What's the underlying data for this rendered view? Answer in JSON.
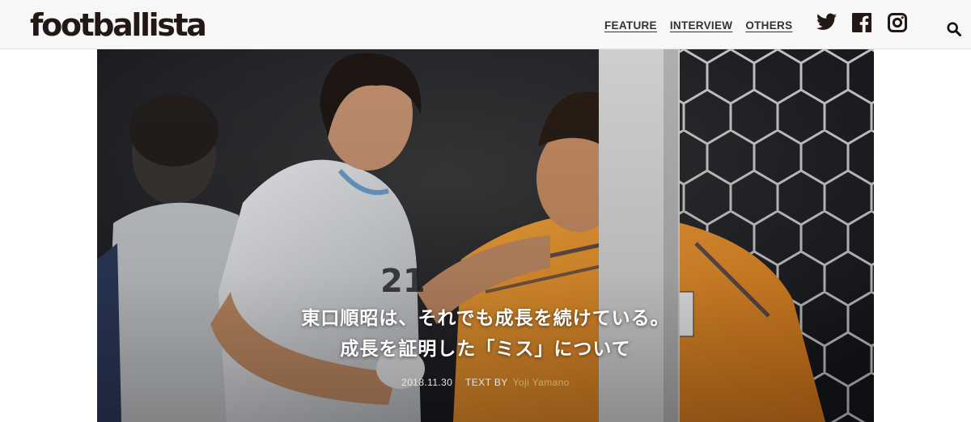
{
  "header": {
    "logo": "footballista",
    "nav": [
      {
        "label": "FEATURE"
      },
      {
        "label": "INTERVIEW"
      },
      {
        "label": "OTHERS"
      }
    ],
    "social_icons": [
      "twitter-icon",
      "facebook-icon",
      "instagram-icon"
    ],
    "search_icon": "search-icon"
  },
  "article": {
    "title_line1": "東口順昭は、それでも成長を続けている。",
    "title_line2": "成長を証明した「ミス」について",
    "date": "2018.11.30",
    "text_by_label": "TEXT BY",
    "author": "Yoji Yamano"
  },
  "colors": {
    "header_bg": "#f7f7f7",
    "logo": "#231815",
    "author_link": "#c9a96a",
    "goalkeeper_kit": "#f29a2e",
    "uruguay_kit": "#e8eaec"
  }
}
